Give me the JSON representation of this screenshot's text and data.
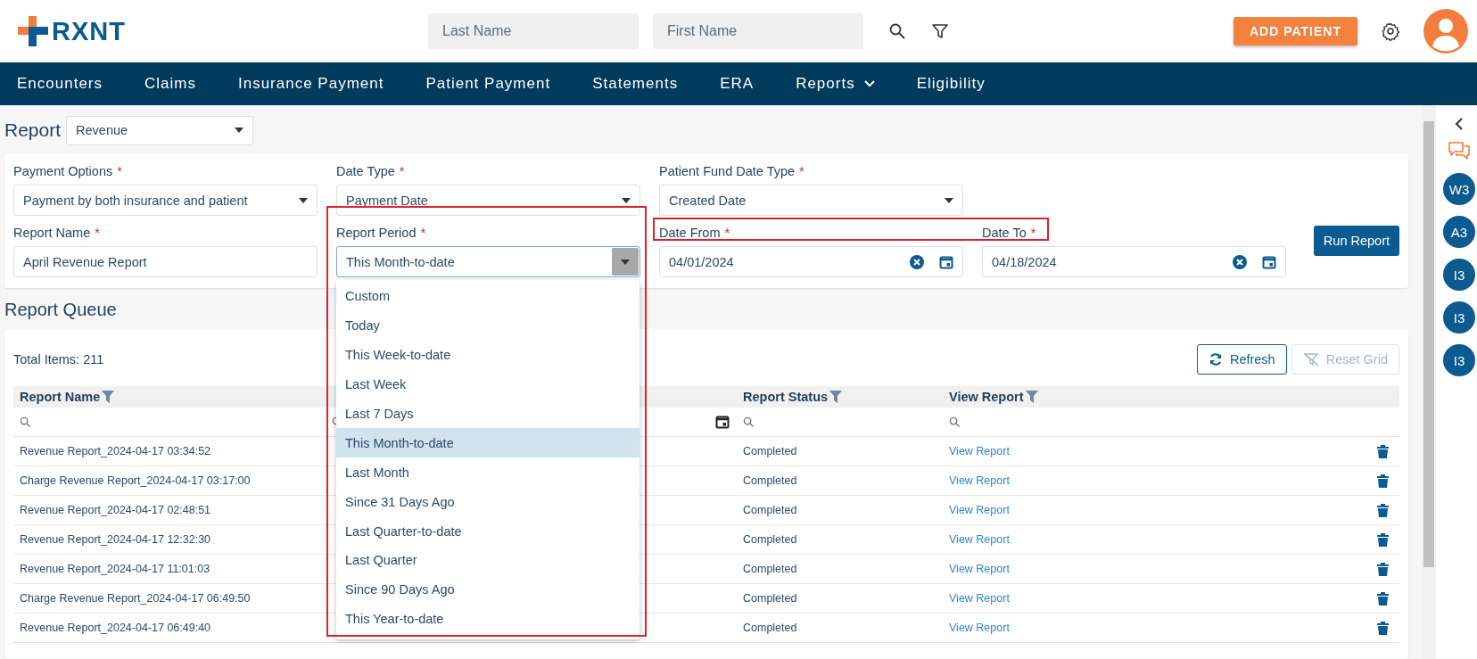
{
  "header": {
    "logo": "RXNT",
    "last_name_placeholder": "Last Name",
    "first_name_placeholder": "First Name",
    "add_patient": "ADD PATIENT"
  },
  "nav": [
    {
      "label": "Encounters",
      "has_menu": false
    },
    {
      "label": "Claims",
      "has_menu": false
    },
    {
      "label": "Insurance Payment",
      "has_menu": false
    },
    {
      "label": "Patient Payment",
      "has_menu": false
    },
    {
      "label": "Statements",
      "has_menu": false
    },
    {
      "label": "ERA",
      "has_menu": false
    },
    {
      "label": "Reports",
      "has_menu": true
    },
    {
      "label": "Eligibility",
      "has_menu": false
    }
  ],
  "required_mark": "*",
  "report_select": {
    "label": "Report",
    "value": "Revenue"
  },
  "fields": [
    {
      "kind": "select",
      "label": "Payment Options",
      "required": true,
      "value": "Payment by both insurance and patient"
    },
    {
      "kind": "select",
      "label": "Date Type",
      "required": true,
      "value": "Payment Date"
    },
    {
      "kind": "select",
      "label": "Patient Fund Date Type",
      "required": true,
      "value": "Created Date"
    },
    {
      "kind": "text",
      "label": "Report Name",
      "required": true,
      "value": "April Revenue Report"
    },
    {
      "kind": "combo",
      "label": "Report Period",
      "required": true,
      "value": "This Month-to-date",
      "expanded": true
    },
    {
      "kind": "date",
      "label": "Date From",
      "required": true,
      "value": "04/01/2024"
    },
    {
      "kind": "date",
      "label": "Date To",
      "required": true,
      "value": "04/18/2024"
    }
  ],
  "run_report": "Run Report",
  "period_options": [
    {
      "label": "Custom",
      "selected": false
    },
    {
      "label": "Today",
      "selected": false
    },
    {
      "label": "This Week-to-date",
      "selected": false
    },
    {
      "label": "Last Week",
      "selected": false
    },
    {
      "label": "Last 7 Days",
      "selected": false
    },
    {
      "label": "This Month-to-date",
      "selected": true
    },
    {
      "label": "Last Month",
      "selected": false
    },
    {
      "label": "Since 31 Days Ago",
      "selected": false
    },
    {
      "label": "Last Quarter-to-date",
      "selected": false
    },
    {
      "label": "Last Quarter",
      "selected": false
    },
    {
      "label": "Since 90 Days Ago",
      "selected": false
    },
    {
      "label": "This Year-to-date",
      "selected": false
    }
  ],
  "queue": {
    "title": "Report Queue",
    "total": "Total Items: 211",
    "refresh": {
      "label": "Refresh",
      "disabled": false
    },
    "reset_grid": {
      "label": "Reset Grid",
      "disabled": true
    },
    "columns": [
      {
        "label": "Report Name",
        "filter": true
      },
      {
        "label": "Report Status",
        "filter": true
      },
      {
        "label": "View Report",
        "filter": true
      }
    ],
    "rows": [
      {
        "name": "Revenue Report_2024-04-17 03:34:52",
        "status": "Completed",
        "link": "View Report"
      },
      {
        "name": "Charge Revenue Report_2024-04-17 03:17:00",
        "status": "Completed",
        "link": "View Report"
      },
      {
        "name": "Revenue Report_2024-04-17 02:48:51",
        "status": "Completed",
        "link": "View Report"
      },
      {
        "name": "Revenue Report_2024-04-17 12:32:30",
        "status": "Completed",
        "link": "View Report"
      },
      {
        "name": "Revenue Report_2024-04-17 11:01:03",
        "status": "Completed",
        "link": "View Report"
      },
      {
        "name": "Charge Revenue Report_2024-04-17 06:49:50",
        "status": "Completed",
        "link": "View Report"
      },
      {
        "name": "Revenue Report_2024-04-17 06:49:40",
        "status": "Completed",
        "link": "View Report"
      }
    ]
  },
  "sidebar": {
    "badges": [
      "W3",
      "A3",
      "I3",
      "I3",
      "I3"
    ]
  }
}
